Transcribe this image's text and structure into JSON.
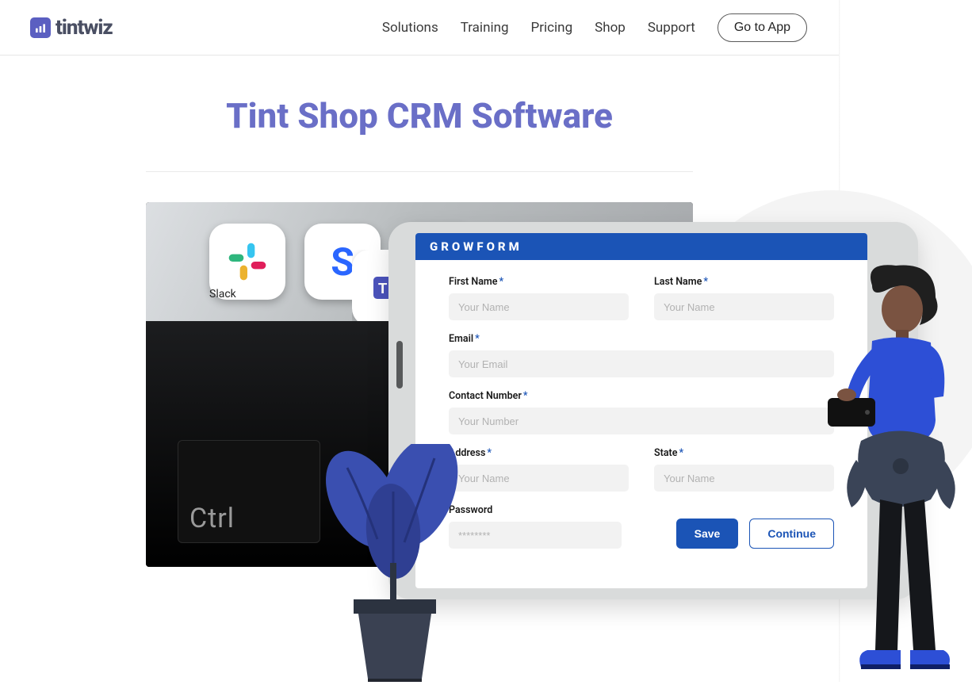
{
  "brand": {
    "name": "tintwiz"
  },
  "nav": {
    "items": [
      "Solutions",
      "Training",
      "Pricing",
      "Shop",
      "Support"
    ],
    "cta": "Go to App"
  },
  "page": {
    "title": "Tint Shop CRM Software"
  },
  "hero_back": {
    "app_icons": [
      "Slack",
      "Teams"
    ],
    "key_label": "Ctrl"
  },
  "form": {
    "header": "GROWFORM",
    "fields": {
      "first_name": {
        "label": "First Name",
        "placeholder": "Your Name"
      },
      "last_name": {
        "label": "Last Name",
        "placeholder": "Your Name"
      },
      "email": {
        "label": "Email",
        "placeholder": "Your Email"
      },
      "contact": {
        "label": "Contact  Number",
        "placeholder": "Your Number"
      },
      "address": {
        "label": "Address",
        "placeholder": "Your Name"
      },
      "state": {
        "label": "State",
        "placeholder": "Your Name"
      },
      "password": {
        "label": "Password",
        "placeholder": "********"
      }
    },
    "actions": {
      "save": "Save",
      "continue": "Continue"
    }
  }
}
